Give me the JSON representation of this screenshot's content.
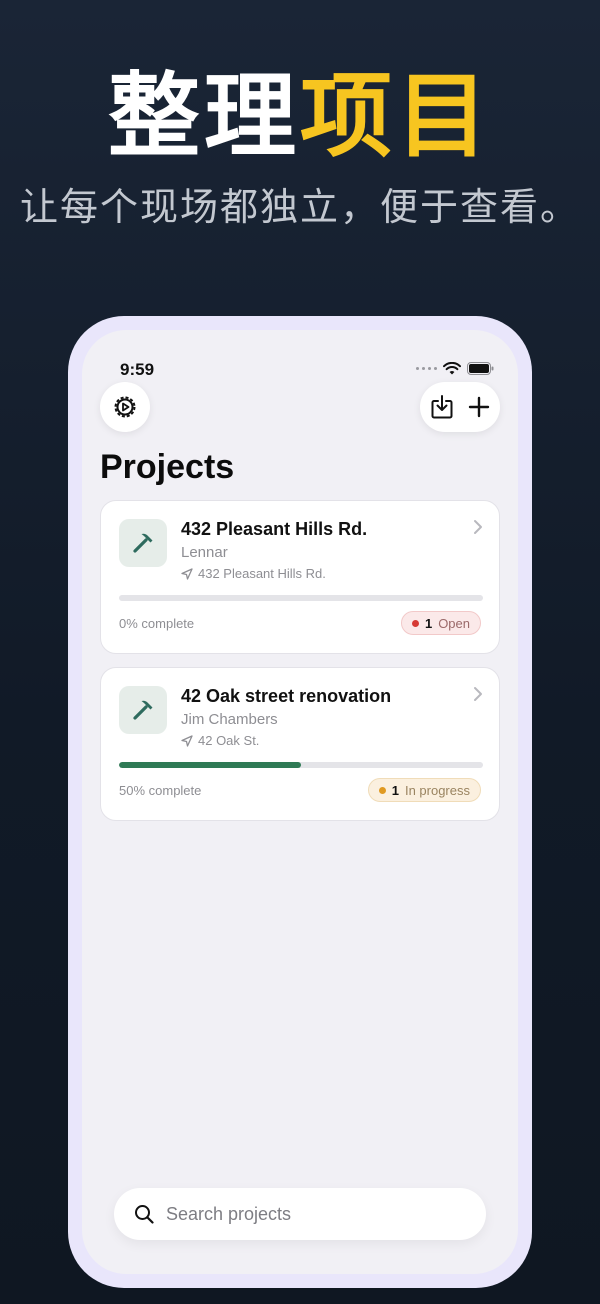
{
  "hero": {
    "title_white": "整理",
    "title_yellow": "项目",
    "subtitle": "让每个现场都独立，便于查看。"
  },
  "status_bar": {
    "time": "9:59"
  },
  "header": {
    "title": "Projects"
  },
  "projects": [
    {
      "title": "432 Pleasant Hills Rd.",
      "client": "Lennar",
      "address": "432 Pleasant Hills Rd.",
      "progress": 0,
      "progress_label": "0% complete",
      "badge_count": "1",
      "badge_label": "Open",
      "badge_color": "#d63a35"
    },
    {
      "title": "42 Oak street renovation",
      "client": "Jim Chambers",
      "address": "42 Oak St.",
      "progress": 0.5,
      "progress_label": "50% complete",
      "badge_count": "1",
      "badge_label": "In progress",
      "badge_color": "#e09a22"
    }
  ],
  "search": {
    "placeholder": "Search projects",
    "value": ""
  },
  "colors": {
    "accent_yellow": "#f7c520",
    "progress_green": "#2f7a55",
    "icon_tile": "#e6ede9"
  },
  "icons": [
    "settings-gear-icon",
    "import-icon",
    "plus-icon",
    "hammer-icon",
    "location-arrow-icon",
    "chevron-right-icon",
    "search-icon",
    "wifi-icon",
    "battery-icon"
  ]
}
